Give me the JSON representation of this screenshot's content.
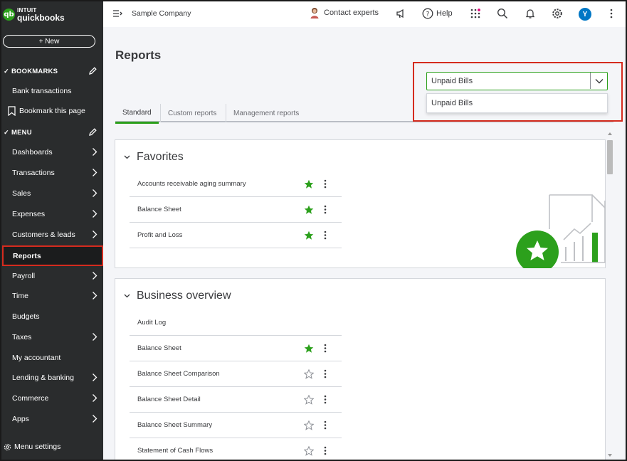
{
  "brand": {
    "badge": "qb",
    "intuit": "INTUIT",
    "name": "quickbooks"
  },
  "sidebar": {
    "new_label": "+ New",
    "bookmarks_heading": "BOOKMARKS",
    "bookmark_items": [
      {
        "label": "Bank transactions"
      },
      {
        "label": "Bookmark this page"
      }
    ],
    "menu_heading": "MENU",
    "menu_items": [
      {
        "label": "Dashboards",
        "has_arrow": true
      },
      {
        "label": "Transactions",
        "has_arrow": true
      },
      {
        "label": "Sales",
        "has_arrow": true
      },
      {
        "label": "Expenses",
        "has_arrow": true
      },
      {
        "label": "Customers & leads",
        "has_arrow": true
      },
      {
        "label": "Reports",
        "has_arrow": false,
        "active": true
      },
      {
        "label": "Payroll",
        "has_arrow": true
      },
      {
        "label": "Time",
        "has_arrow": true
      },
      {
        "label": "Budgets",
        "has_arrow": false
      },
      {
        "label": "Taxes",
        "has_arrow": true
      },
      {
        "label": "My accountant",
        "has_arrow": false
      },
      {
        "label": "Lending & banking",
        "has_arrow": true
      },
      {
        "label": "Commerce",
        "has_arrow": true
      },
      {
        "label": "Apps",
        "has_arrow": true
      }
    ],
    "menu_settings": "Menu settings"
  },
  "topbar": {
    "company": "Sample Company",
    "contact": "Contact experts",
    "help": "Help",
    "user_initial": "Y"
  },
  "page": {
    "title": "Reports",
    "tabs": [
      {
        "label": "Standard",
        "active": true
      },
      {
        "label": "Custom reports",
        "active": false
      },
      {
        "label": "Management reports",
        "active": false
      }
    ],
    "search": {
      "value": "Unpaid Bills",
      "suggestion": "Unpaid Bills"
    }
  },
  "sections": [
    {
      "title": "Favorites",
      "rows": [
        {
          "label": "Accounts receivable aging summary",
          "starred": true
        },
        {
          "label": "Balance Sheet",
          "starred": true
        },
        {
          "label": "Profit and Loss",
          "starred": true
        }
      ]
    },
    {
      "title": "Business overview",
      "rows": [
        {
          "label": "Audit Log",
          "starred": null
        },
        {
          "label": "Balance Sheet",
          "starred": true
        },
        {
          "label": "Balance Sheet Comparison",
          "starred": false
        },
        {
          "label": "Balance Sheet Detail",
          "starred": false
        },
        {
          "label": "Balance Sheet Summary",
          "starred": false
        },
        {
          "label": "Statement of Cash Flows",
          "starred": false
        }
      ]
    }
  ],
  "colors": {
    "brand_green": "#2ca01c",
    "sidebar_bg": "#2a2c2d",
    "highlight_red": "#d52b1e",
    "avatar_blue": "#0077c5"
  }
}
